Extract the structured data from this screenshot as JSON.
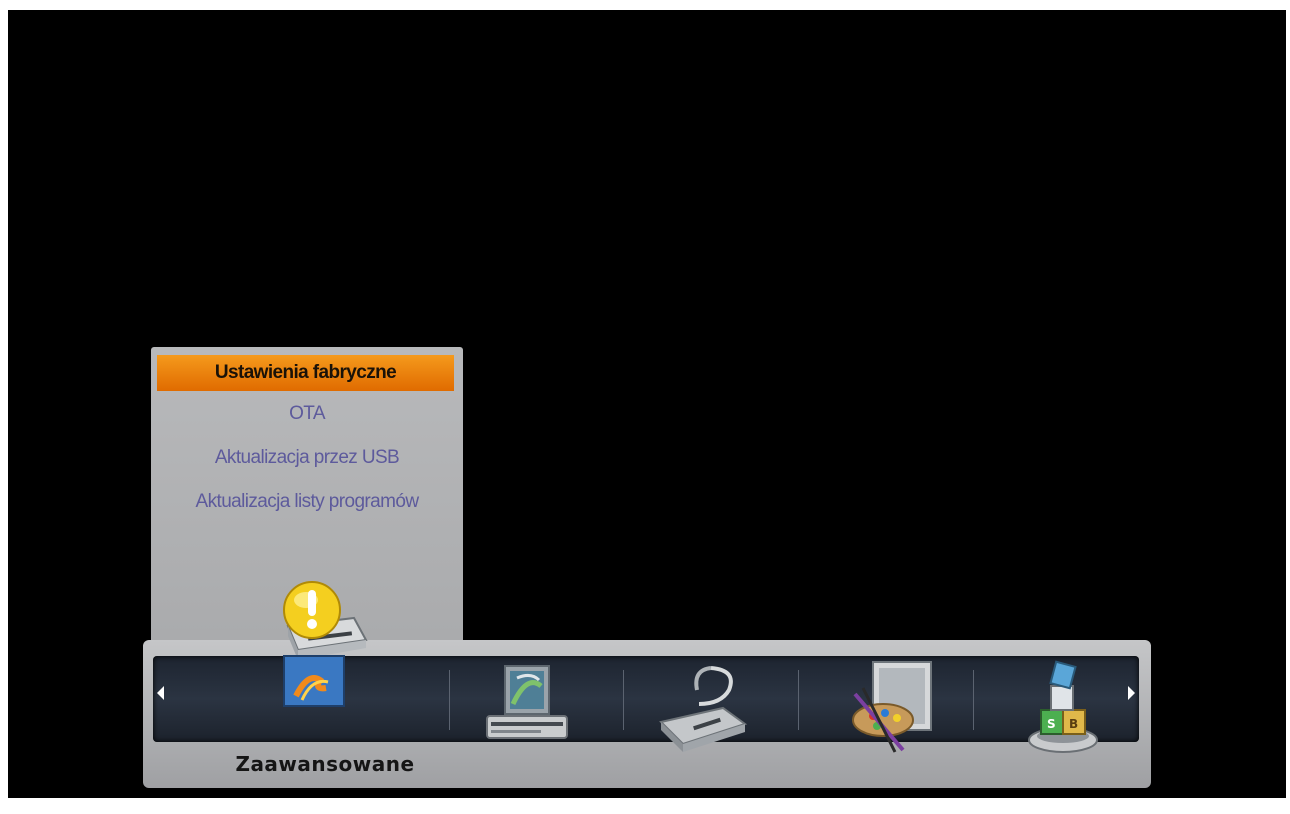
{
  "submenu": {
    "items": [
      {
        "label": "Ustawienia fabryczne",
        "selected": true
      },
      {
        "label": "OTA",
        "selected": false
      },
      {
        "label": "Aktualizacja przez USB",
        "selected": false
      },
      {
        "label": "Aktualizacja listy programów",
        "selected": false
      }
    ]
  },
  "main_menu": {
    "selected_caption": "Zaawansowane",
    "icons": [
      "advanced-warning-icon",
      "image-settings-icon",
      "installation-icon",
      "system-settings-icon",
      "games-icon"
    ]
  },
  "colors": {
    "highlight": "#e07800",
    "item_text": "#5d5a9c",
    "panel": "#b0b1b3",
    "bar_inner": "#262e3a"
  }
}
